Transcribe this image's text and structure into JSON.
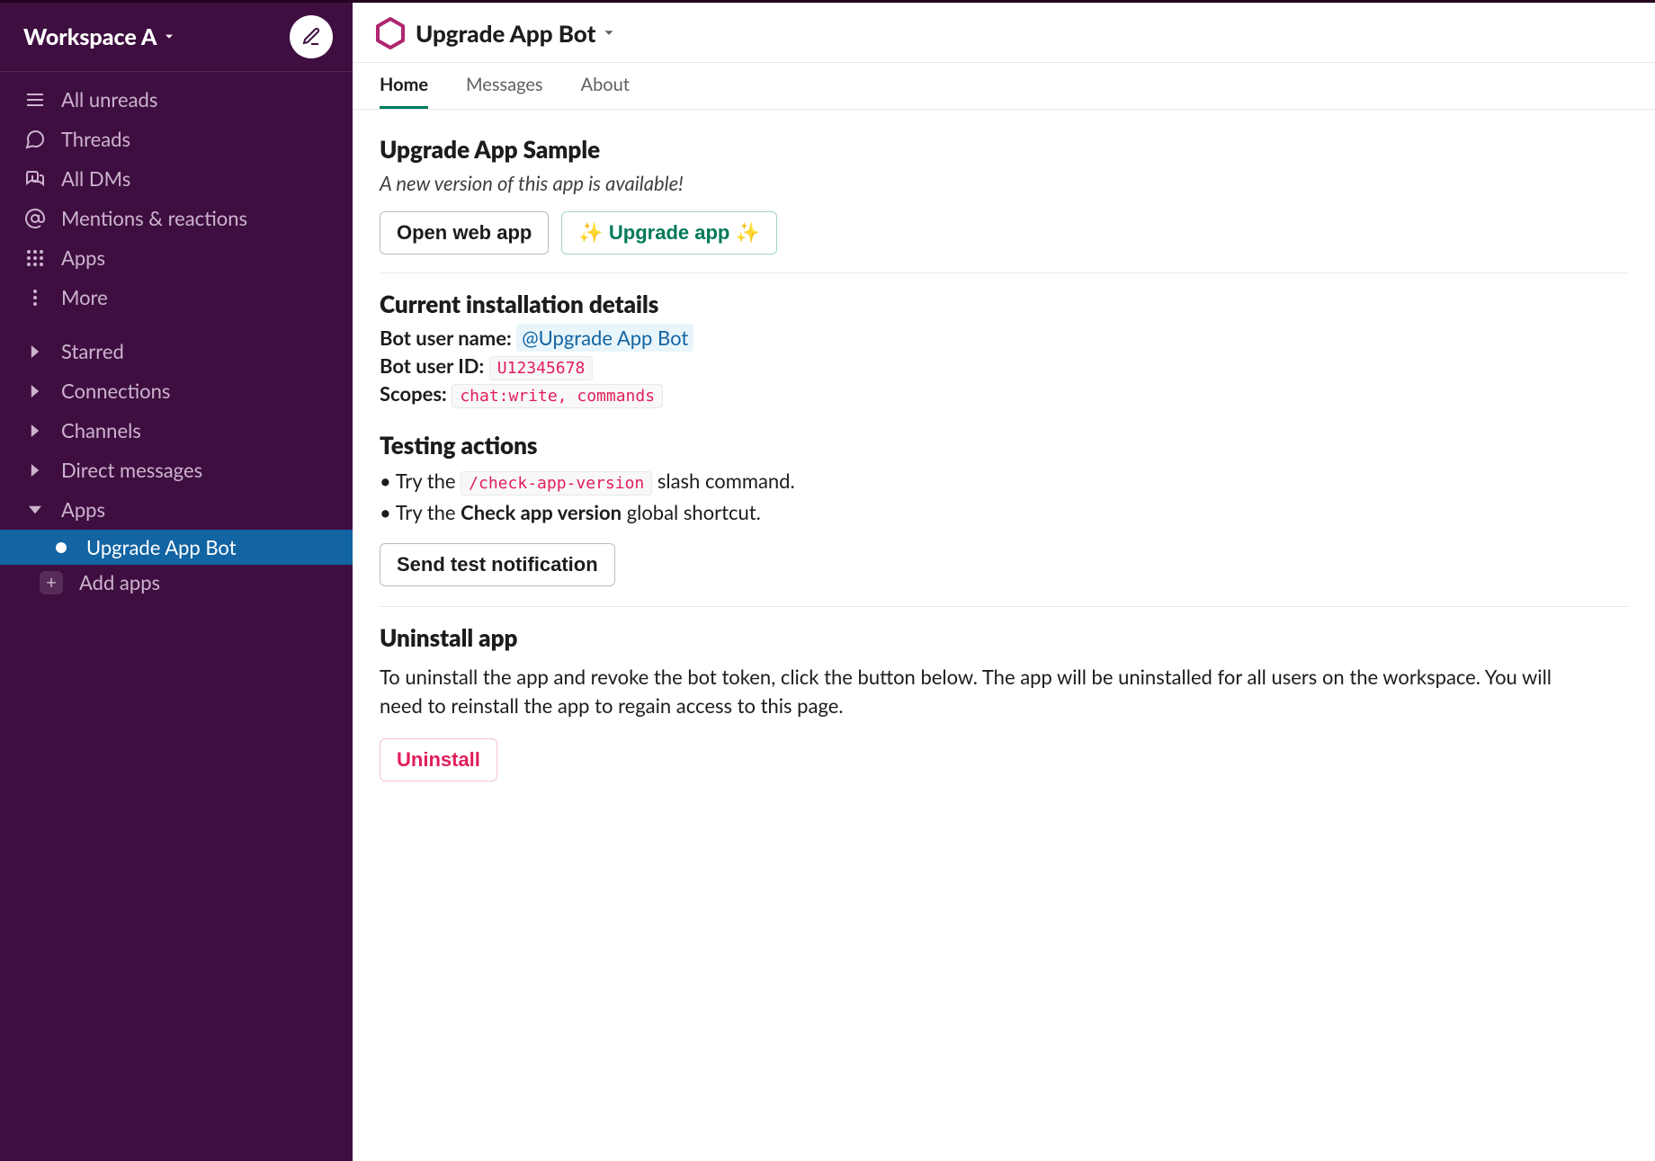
{
  "workspace": {
    "name": "Workspace A"
  },
  "sidebar": {
    "top": [
      {
        "icon": "menu-icon",
        "label": "All unreads"
      },
      {
        "icon": "threads-icon",
        "label": "Threads"
      },
      {
        "icon": "dm-icon",
        "label": "All DMs"
      },
      {
        "icon": "at-icon",
        "label": "Mentions & reactions"
      },
      {
        "icon": "apps-icon",
        "label": "Apps"
      },
      {
        "icon": "more-icon",
        "label": "More"
      }
    ],
    "sections": [
      {
        "label": "Starred",
        "expanded": false
      },
      {
        "label": "Connections",
        "expanded": false
      },
      {
        "label": "Channels",
        "expanded": false
      },
      {
        "label": "Direct messages",
        "expanded": false
      },
      {
        "label": "Apps",
        "expanded": true
      }
    ],
    "apps": {
      "active_item": "Upgrade App Bot",
      "add_label": "Add apps"
    }
  },
  "header": {
    "title": "Upgrade App Bot"
  },
  "tabs": [
    {
      "label": "Home",
      "active": true
    },
    {
      "label": "Messages",
      "active": false
    },
    {
      "label": "About",
      "active": false
    }
  ],
  "home": {
    "hero": {
      "title": "Upgrade App Sample",
      "subtitle": "A new version of this app is available!",
      "open_btn": "Open web app",
      "upgrade_btn": "Upgrade app"
    },
    "install": {
      "heading": "Current installation details",
      "bot_name_label": "Bot user name:",
      "bot_name_value": "@Upgrade App Bot",
      "bot_id_label": "Bot user ID:",
      "bot_id_value": "U12345678",
      "scopes_label": "Scopes:",
      "scopes_value": "chat:write, commands"
    },
    "testing": {
      "heading": "Testing actions",
      "line1_pre": "Try the ",
      "line1_code": "/check-app-version",
      "line1_post": " slash command.",
      "line2_pre": "Try the ",
      "line2_bold": "Check app version",
      "line2_post": " global shortcut.",
      "send_btn": "Send test notification"
    },
    "uninstall": {
      "heading": "Uninstall app",
      "body": "To uninstall the app and revoke the bot token, click the button below. The app will be uninstalled for all users on the workspace. You will need to reinstall the app to regain access to this page.",
      "btn": "Uninstall"
    }
  }
}
